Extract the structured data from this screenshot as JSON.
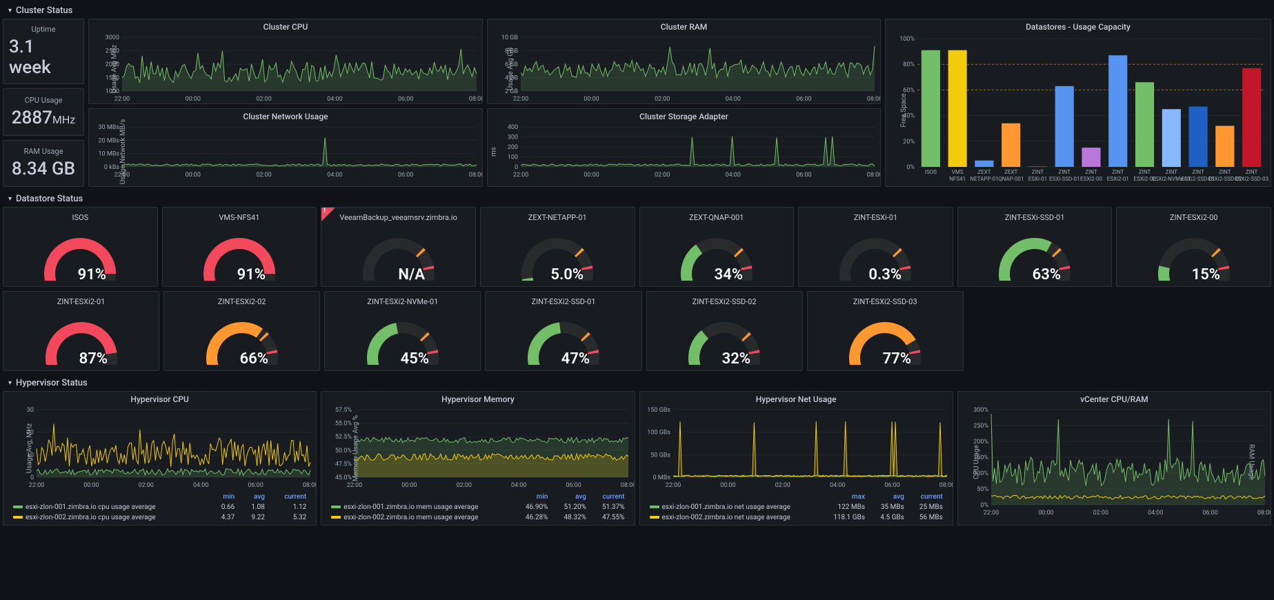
{
  "sections": {
    "cluster": "Cluster Status",
    "datastore": "Datastore Status",
    "hypervisor": "Hypervisor Status"
  },
  "stats": {
    "uptime_label": "Uptime",
    "uptime_value": "3.1 week",
    "cpu_label": "CPU Usage",
    "cpu_value": "2887",
    "cpu_unit": "MHz",
    "ram_label": "RAM Usage",
    "ram_value": "8.34 GB"
  },
  "cluster_charts": {
    "cpu": {
      "title": "Cluster CPU",
      "ylabel": "Usage Avg  MHz",
      "yticks": [
        "1000",
        "1500",
        "2000",
        "2500",
        "3000"
      ],
      "xticks": [
        "22:00",
        "00:00",
        "02:00",
        "04:00",
        "06:00",
        "08:00"
      ]
    },
    "ram": {
      "title": "Cluster RAM",
      "ylabel": "Usage Avg  GB",
      "yticks": [
        "2 GB",
        "4 GB",
        "6 GB",
        "8 GB",
        "10 GB"
      ],
      "xticks": [
        "22:00",
        "00:00",
        "02:00",
        "04:00",
        "06:00",
        "08:00"
      ]
    },
    "net": {
      "title": "Cluster Network Usage",
      "ylabel": "Usage Network MB/s",
      "yticks": [
        "0 kBs",
        "10 MBs",
        "20 MBs",
        "30 MBs"
      ],
      "xticks": [
        "22:00",
        "00:00",
        "02:00",
        "04:00",
        "06:00",
        "08:00"
      ]
    },
    "storage": {
      "title": "Cluster Storage Adapter",
      "ylabel": "ms",
      "yticks": [
        "0",
        "100",
        "200",
        "300",
        "400"
      ],
      "xticks": [
        "22:00",
        "00:00",
        "02:00",
        "04:00",
        "06:00",
        "08:00"
      ]
    }
  },
  "chart_data": {
    "type": "bar",
    "title": "Datastores - Usage Capacity",
    "ylabel": "Free Space",
    "ylim": [
      0,
      100
    ],
    "yticks": [
      "0%",
      "20%",
      "40%",
      "60%",
      "80%",
      "100%"
    ],
    "categories": [
      "ISOS",
      "VMS-NFS41",
      "ZEXT-NETAPP-01",
      "ZEXT-QNAP-001",
      "ZINT-ESXi-01",
      "ZINT-ESXi-SSD-01",
      "ZINT-ESXi2-00",
      "ZINT-ESXi2-01",
      "ZINT-ESXi2-02",
      "ZINT-ESXi2-NVMe-01",
      "ZINT-ESXi2-SSD-01",
      "ZINT-ESXi2-SSD-02",
      "ZINT-ESXi2-SSD-03"
    ],
    "values": [
      91,
      91,
      5,
      34,
      0.3,
      63,
      15,
      87,
      66,
      45,
      47,
      32,
      77
    ],
    "colors": [
      "#73bf69",
      "#f2cc0c",
      "#5794f2",
      "#ff9830",
      "#f2495c",
      "#5794f2",
      "#b877d9",
      "#5794f2",
      "#73bf69",
      "#8ab8ff",
      "#1f60c4",
      "#ff9830",
      "#c4162a"
    ],
    "thresholds": [
      60,
      80
    ]
  },
  "gauges": [
    {
      "title": "ISOS",
      "value": "91%",
      "pct": 91,
      "color": "#f2495c"
    },
    {
      "title": "VMS-NFS41",
      "value": "91%",
      "pct": 91,
      "color": "#f2495c"
    },
    {
      "title": "VeeamBackup_veeamsrv.zimbra.io",
      "value": "N/A",
      "pct": 0,
      "color": "#73bf69",
      "alert": true
    },
    {
      "title": "ZEXT-NETAPP-01",
      "value": "5.0%",
      "pct": 5,
      "color": "#73bf69"
    },
    {
      "title": "ZEXT-QNAP-001",
      "value": "34%",
      "pct": 34,
      "color": "#73bf69"
    },
    {
      "title": "ZINT-ESXi-01",
      "value": "0.3%",
      "pct": 0.3,
      "color": "#73bf69"
    },
    {
      "title": "ZINT-ESXi-SSD-01",
      "value": "63%",
      "pct": 63,
      "color": "#73bf69"
    },
    {
      "title": "ZINT-ESXi2-00",
      "value": "15%",
      "pct": 15,
      "color": "#73bf69"
    },
    {
      "title": "ZINT-ESXi2-01",
      "value": "87%",
      "pct": 87,
      "color": "#f2495c"
    },
    {
      "title": "ZINT-ESXi2-02",
      "value": "66%",
      "pct": 66,
      "color": "#ff9830"
    },
    {
      "title": "ZINT-ESXi2-NVMe-01",
      "value": "45%",
      "pct": 45,
      "color": "#73bf69"
    },
    {
      "title": "ZINT-ESXi2-SSD-01",
      "value": "47%",
      "pct": 47,
      "color": "#73bf69"
    },
    {
      "title": "ZINT-ESXi2-SSD-02",
      "value": "32%",
      "pct": 32,
      "color": "#73bf69"
    },
    {
      "title": "ZINT-ESXi2-SSD-03",
      "value": "77%",
      "pct": 77,
      "color": "#ff9830"
    }
  ],
  "hypervisor": {
    "cpu": {
      "title": "Hypervisor CPU",
      "ylabel": "Usage Avg, MHz",
      "yticks": [
        "0",
        "10",
        "20",
        "30"
      ],
      "xticks": [
        "22:00",
        "00:00",
        "02:00",
        "04:00",
        "06:00",
        "08:00"
      ],
      "cols": [
        "min",
        "avg",
        "current"
      ],
      "series": [
        {
          "name": "esxi-zlon-001.zimbra.io cpu usage average",
          "color": "#73bf69",
          "stats": [
            "0.66",
            "1.08",
            "1.12"
          ]
        },
        {
          "name": "esxi-zlon-002.zimbra.io cpu usage average",
          "color": "#f2cc0c",
          "stats": [
            "4.37",
            "9.22",
            "5.32"
          ]
        }
      ]
    },
    "mem": {
      "title": "Hypervisor Memory",
      "ylabel": "Memory Usage Avg  %",
      "yticks": [
        "45.0%",
        "47.5%",
        "50.0%",
        "52.5%",
        "55.0%",
        "57.5%"
      ],
      "xticks": [
        "22:00",
        "00:00",
        "02:00",
        "04:00",
        "06:00",
        "08:00"
      ],
      "cols": [
        "min",
        "avg",
        "current"
      ],
      "series": [
        {
          "name": "esxi-zlon-001.zimbra.io mem usage average",
          "color": "#73bf69",
          "stats": [
            "46.90%",
            "51.20%",
            "51.37%"
          ]
        },
        {
          "name": "esxi-zlon-002.zimbra.io mem usage average",
          "color": "#f2cc0c",
          "stats": [
            "46.28%",
            "48.32%",
            "47.55%"
          ]
        }
      ]
    },
    "net": {
      "title": "Hypervisor Net Usage",
      "ylabel": "",
      "yticks": [
        "0 MBs",
        "50 GBs",
        "100 GBs",
        "150 GBs"
      ],
      "xticks": [
        "22:00",
        "00:00",
        "02:00",
        "04:00",
        "06:00",
        "08:00"
      ],
      "cols": [
        "max",
        "avg",
        "current"
      ],
      "series": [
        {
          "name": "esxi-zlon-001.zimbra.io net usage average",
          "color": "#73bf69",
          "stats": [
            "122 MBs",
            "35 MBs",
            "25 MBs"
          ]
        },
        {
          "name": "esxi-zlon-002.zimbra.io net usage average",
          "color": "#f2cc0c",
          "stats": [
            "118.1 GBs",
            "4.5 GBs",
            "56 MBs"
          ]
        }
      ]
    },
    "vcenter": {
      "title": "vCenter CPU/RAM",
      "ylabel_left": "CPU Usage",
      "ylabel_right": "RAM Usage",
      "yticks": [
        "0%",
        "50%",
        "100%",
        "150%",
        "200%",
        "250%",
        "300%"
      ],
      "xticks": [
        "22:00",
        "00:00",
        "02:00",
        "04:00",
        "06:00",
        "08:00"
      ]
    }
  }
}
